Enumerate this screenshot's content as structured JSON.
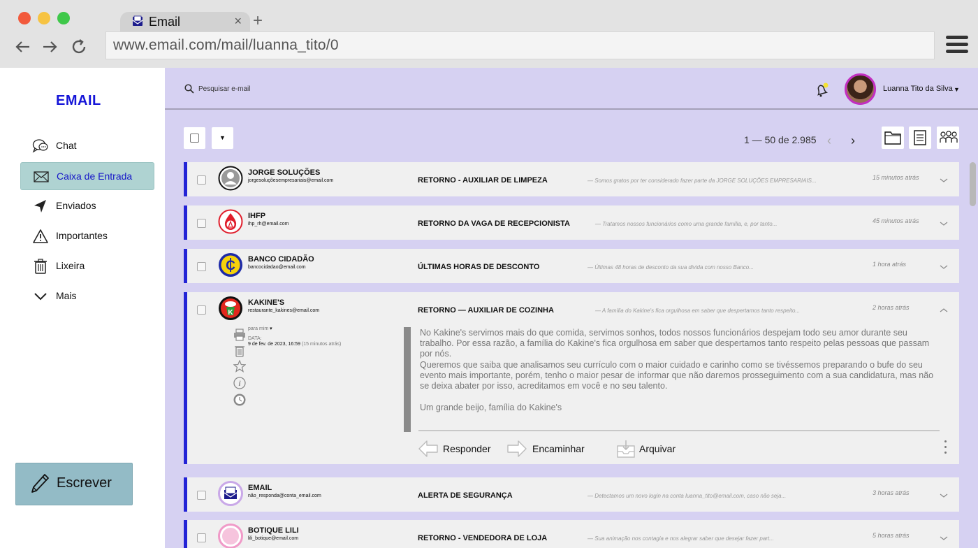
{
  "browser": {
    "tab_title": "Email",
    "tab_close": "×",
    "new_tab": "+",
    "url": "www.email.com/mail/luanna_tito/0"
  },
  "sidebar": {
    "brand": "EMAIL",
    "items": [
      {
        "label": "Chat",
        "icon": "chat-icon"
      },
      {
        "label": "Caixa de Entrada",
        "icon": "envelope-icon",
        "active": true
      },
      {
        "label": "Enviados",
        "icon": "send-icon"
      },
      {
        "label": "Importantes",
        "icon": "warning-icon"
      },
      {
        "label": "Lixeira",
        "icon": "trash-icon"
      },
      {
        "label": "Mais",
        "icon": "chevron-down-icon"
      }
    ],
    "compose_label": "Escrever"
  },
  "topbar": {
    "search_placeholder": "Pesquisar e-mail",
    "user_name": "Luanna Tito da Silva",
    "user_caret": "▼"
  },
  "toolbar": {
    "dropdown": "▼",
    "pagination": "1 — 50 de 2.985",
    "prev": "‹",
    "next": "›"
  },
  "emails": [
    {
      "sender": "JORGE SOLUÇÕES",
      "address": "jorgesoluçõesempresariais@email.com",
      "subject": "RETORNO - AUXILIAR DE LIMPEZA",
      "preview": "— Somos gratos por ter considerado fazer parte da JORGE SOLUÇÕES EMPRESARIAIS...",
      "time": "15 minutos atrás"
    },
    {
      "sender": "IHFP",
      "address": "ihp_rh@email.com",
      "subject": "RETORNO DA VAGA DE RECEPCIONISTA",
      "preview": "— Tratamos nossos funcionários como uma grande família, e, por tanto...",
      "time": "45 minutos atrás"
    },
    {
      "sender": "BANCO CIDADÃO",
      "address": "bancocidadao@email.com",
      "subject": "ÚLTIMAS HORAS DE DESCONTO",
      "preview": "— Últimas 48 horas de desconto da sua divida com nosso Banco...",
      "time": "1 hora atrás"
    },
    {
      "sender": "KAKINE'S",
      "address": "restaurante_kakines@email.com",
      "subject": "RETORNO — AUXILIAR DE COZINHA",
      "preview": "— A família do Kakine's fica orgulhosa em saber que despertamos tanto respeito...",
      "time": "2 horas atrás",
      "expanded": {
        "to": "para mim",
        "to_caret": "▾",
        "date_label": "DATA:",
        "date": "9 de fev. de 2023, 16:59",
        "date_relative": "(15 minutos atrás)",
        "paragraphs": [
          "No Kakine's servimos mais do que comida, servimos sonhos, todos nossos funcionários despejam todo seu amor durante seu trabalho. Por essa razão, a família do Kakine's fica orgulhosa em saber que despertamos tanto respeito pelas pessoas que passam por nós.",
          "Queremos que saiba que analisamos seu currículo com o maior cuidado e carinho como se tivéssemos preparando o bufe do seu evento mais importante, porém, tenho o maior pesar de informar que não daremos prosseguimento com a sua candidatura, mas não se deixa abater por isso, acreditamos em você e no seu talento.",
          "Um grande beijo, família do Kakine's"
        ],
        "actions": {
          "reply": "Responder",
          "forward": "Encaminhar",
          "archive": "Arquivar"
        }
      }
    },
    {
      "sender": "EMAIL",
      "address": "não_responda@conta_email.com",
      "subject": "ALERTA DE SEGURANÇA",
      "preview": "— Detectamos um novo login na conta luanna_tito@email.com, caso não seja...",
      "time": "3 horas atrás"
    },
    {
      "sender": "BOTIQUE LILI",
      "address": "lili_botique@email.com",
      "subject": "RETORNO - VENDEDORA DE LOJA",
      "preview": "— Sua animação nos contagia e nos alegrar saber que desejar fazer part...",
      "time": "5 horas atrás"
    }
  ],
  "colors": {
    "accent": "#2323d6",
    "main_bg": "#d6d1f2",
    "active_nav": "#afd3d2",
    "compose_bg": "#93bbc6"
  }
}
